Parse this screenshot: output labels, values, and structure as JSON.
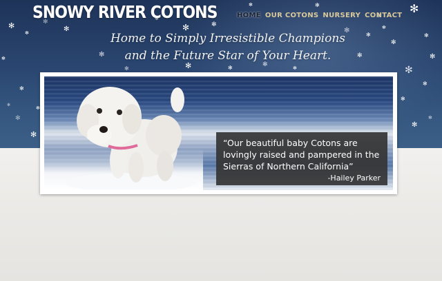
{
  "site": {
    "logo_text": "SNOWY RIVER COTONS"
  },
  "nav": {
    "items": [
      {
        "label": "HOME",
        "active": true
      },
      {
        "label": "OUR COTONS",
        "active": false
      },
      {
        "label": "NURSERY",
        "active": false
      },
      {
        "label": "CONTACT",
        "active": false
      }
    ]
  },
  "hero": {
    "tagline_line1": "Home to Simply Irresistible Champions",
    "tagline_line2": "and the Future Star of Your Heart."
  },
  "banner": {
    "image_subject": "white-cotton-puppy-in-snow",
    "quote": "“Our beautiful baby Cotons are lovingly raised and pampered in the Sierras of Northern California”",
    "author": "-Hailey Parker"
  },
  "colors": {
    "sky": "#2a4670",
    "nav_active": "#1a2133",
    "nav_item": "#d9c99b",
    "quote_box": "#343434",
    "ground": "#ecebe8"
  }
}
